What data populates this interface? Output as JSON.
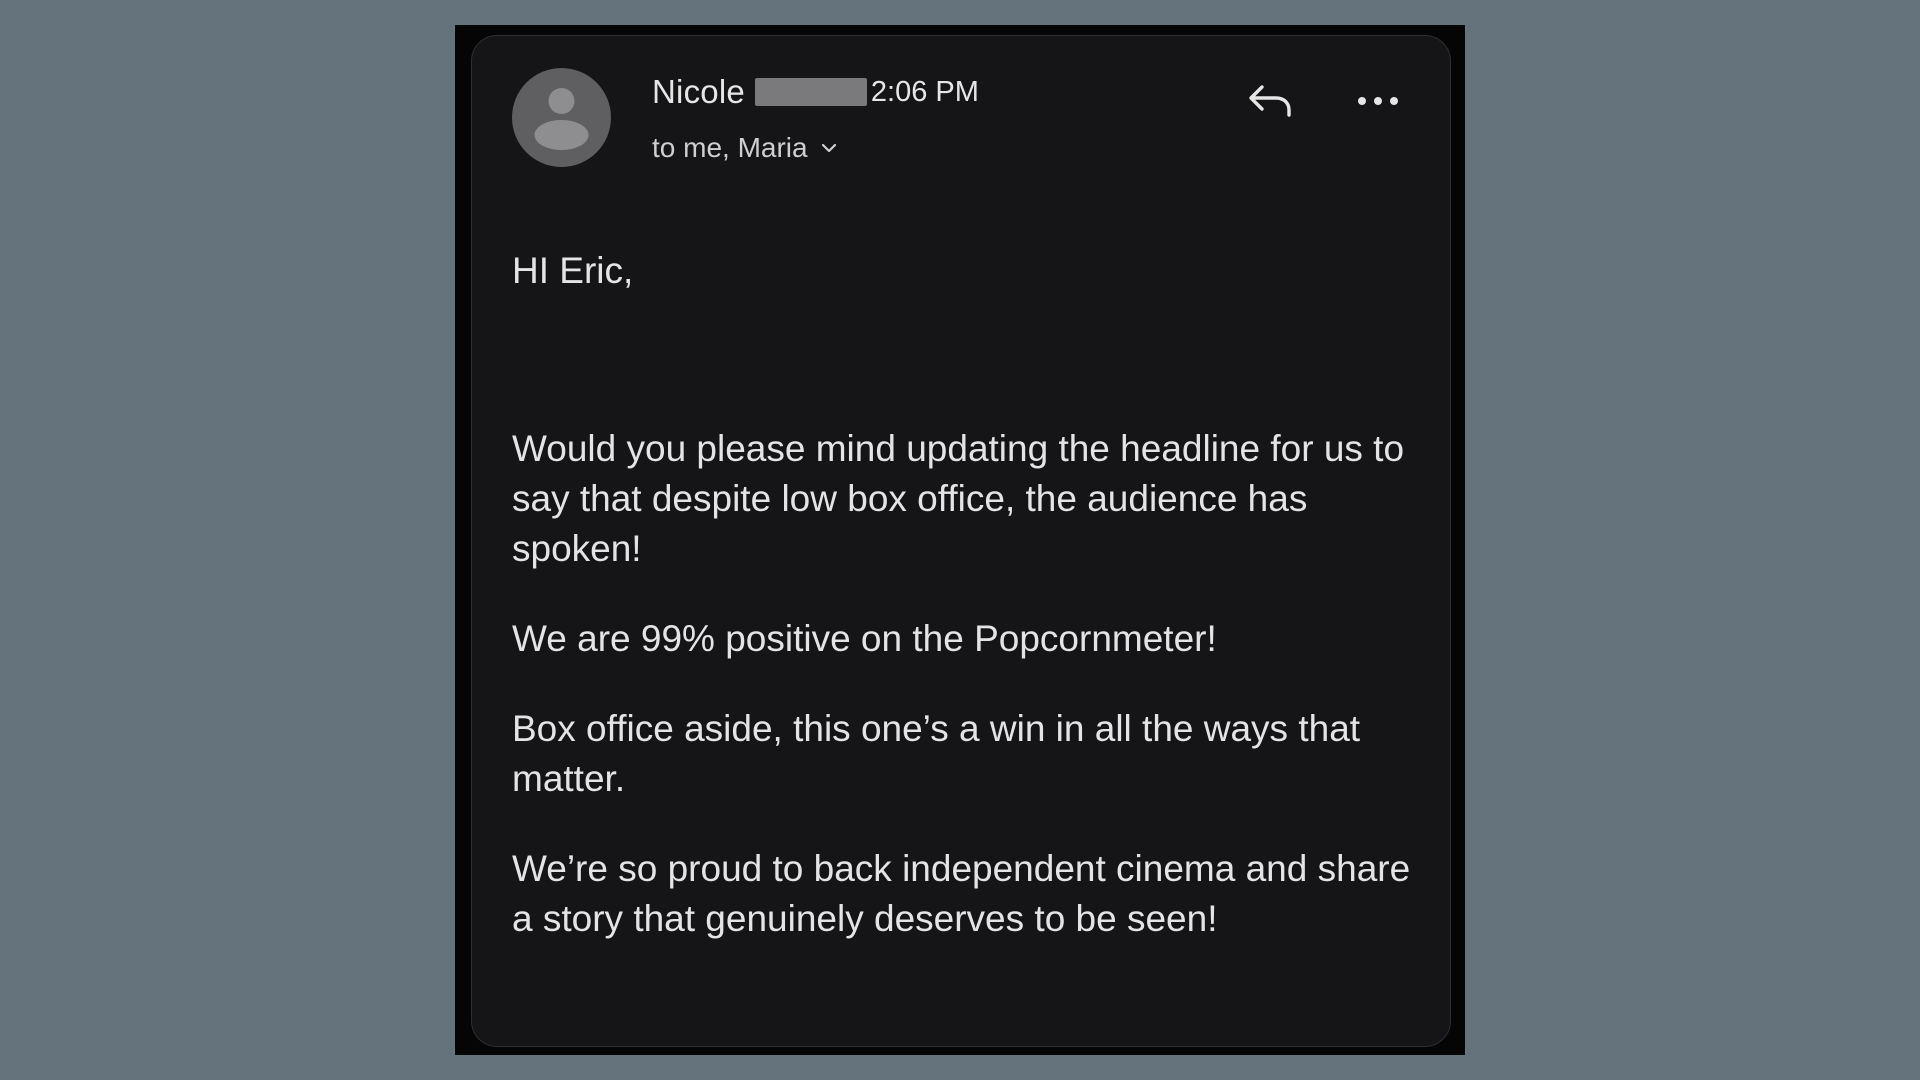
{
  "email": {
    "sender": {
      "name": "Nicole",
      "surname_redacted": true
    },
    "time": "2:06 PM",
    "recipients": "to me, Maria",
    "actions": {
      "reply_icon": "reply-icon",
      "more_icon": "more-options-icon"
    },
    "greeting": "HI Eric,",
    "paragraphs": [
      "Would you please mind updating the headline for us to say that despite low box office, the audience has spoken!",
      "We are 99% positive on the Popcornmeter!",
      "Box office aside, this one’s a win in all the ways that matter.",
      "We’re so proud to back independent cinema and share a story that genuinely deserves to be seen!"
    ]
  },
  "colors": {
    "background": "#65737d",
    "card": "#151518",
    "text": "#e4e4e6",
    "avatar": "#5f5f62"
  }
}
